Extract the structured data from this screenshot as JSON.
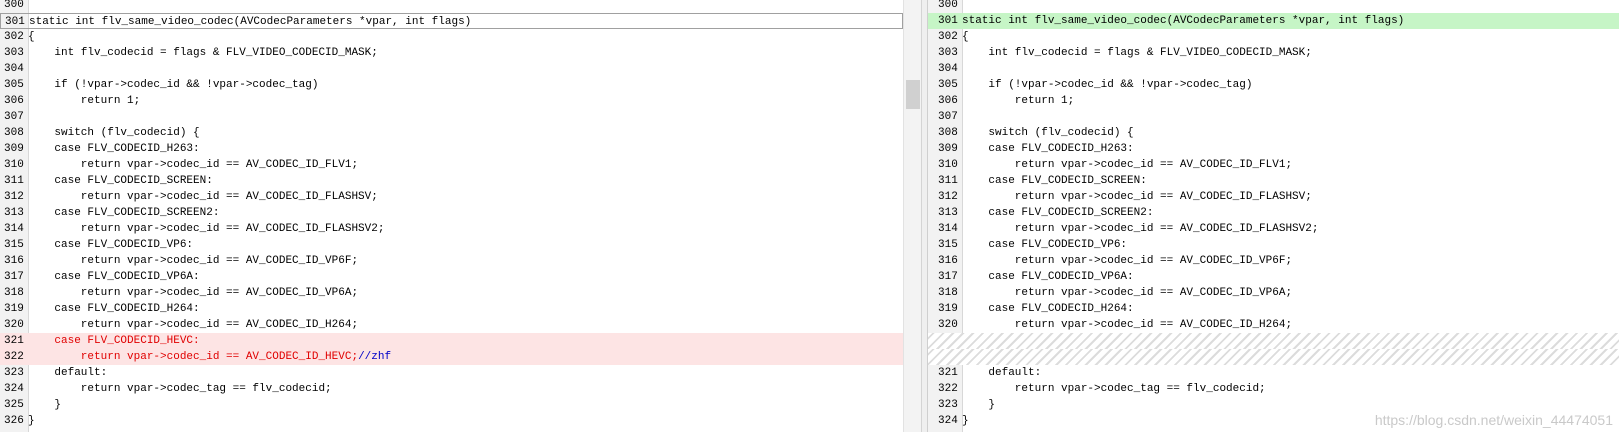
{
  "left_pane": {
    "lines": [
      {
        "num": "300",
        "text": "",
        "style": "normal"
      },
      {
        "num": "301",
        "text": "static int flv_same_video_codec(AVCodecParameters *vpar, int flags)",
        "style": "current"
      },
      {
        "num": "302",
        "text": "{",
        "style": "normal"
      },
      {
        "num": "303",
        "text": "    int flv_codecid = flags & FLV_VIDEO_CODECID_MASK;",
        "style": "normal"
      },
      {
        "num": "304",
        "text": "",
        "style": "normal"
      },
      {
        "num": "305",
        "text": "    if (!vpar->codec_id && !vpar->codec_tag)",
        "style": "normal"
      },
      {
        "num": "306",
        "text": "        return 1;",
        "style": "normal"
      },
      {
        "num": "307",
        "text": "",
        "style": "normal"
      },
      {
        "num": "308",
        "text": "    switch (flv_codecid) {",
        "style": "normal"
      },
      {
        "num": "309",
        "text": "    case FLV_CODECID_H263:",
        "style": "normal"
      },
      {
        "num": "310",
        "text": "        return vpar->codec_id == AV_CODEC_ID_FLV1;",
        "style": "normal"
      },
      {
        "num": "311",
        "text": "    case FLV_CODECID_SCREEN:",
        "style": "normal"
      },
      {
        "num": "312",
        "text": "        return vpar->codec_id == AV_CODEC_ID_FLASHSV;",
        "style": "normal"
      },
      {
        "num": "313",
        "text": "    case FLV_CODECID_SCREEN2:",
        "style": "normal"
      },
      {
        "num": "314",
        "text": "        return vpar->codec_id == AV_CODEC_ID_FLASHSV2;",
        "style": "normal"
      },
      {
        "num": "315",
        "text": "    case FLV_CODECID_VP6:",
        "style": "normal"
      },
      {
        "num": "316",
        "text": "        return vpar->codec_id == AV_CODEC_ID_VP6F;",
        "style": "normal"
      },
      {
        "num": "317",
        "text": "    case FLV_CODECID_VP6A:",
        "style": "normal"
      },
      {
        "num": "318",
        "text": "        return vpar->codec_id == AV_CODEC_ID_VP6A;",
        "style": "normal"
      },
      {
        "num": "319",
        "text": "    case FLV_CODECID_H264:",
        "style": "normal"
      },
      {
        "num": "320",
        "text": "        return vpar->codec_id == AV_CODEC_ID_H264;",
        "style": "normal"
      },
      {
        "num": "321",
        "text": "    case FLV_CODECID_HEVC:",
        "style": "red"
      },
      {
        "num": "322",
        "text": "        return vpar->codec_id == AV_CODEC_ID_HEVC;",
        "comment": "//zhf",
        "style": "red"
      },
      {
        "num": "323",
        "text": "    default:",
        "style": "normal"
      },
      {
        "num": "324",
        "text": "        return vpar->codec_tag == flv_codecid;",
        "style": "normal"
      },
      {
        "num": "325",
        "text": "    }",
        "style": "normal"
      },
      {
        "num": "326",
        "text": "}",
        "style": "normal"
      }
    ]
  },
  "right_pane": {
    "lines": [
      {
        "num": "300",
        "text": "",
        "style": "normal"
      },
      {
        "num": "301",
        "text": "static int flv_same_video_codec(AVCodecParameters *vpar, int flags)",
        "style": "green"
      },
      {
        "num": "302",
        "text": "{",
        "style": "normal"
      },
      {
        "num": "303",
        "text": "    int flv_codecid = flags & FLV_VIDEO_CODECID_MASK;",
        "style": "normal"
      },
      {
        "num": "304",
        "text": "",
        "style": "normal"
      },
      {
        "num": "305",
        "text": "    if (!vpar->codec_id && !vpar->codec_tag)",
        "style": "normal"
      },
      {
        "num": "306",
        "text": "        return 1;",
        "style": "normal"
      },
      {
        "num": "307",
        "text": "",
        "style": "normal"
      },
      {
        "num": "308",
        "text": "    switch (flv_codecid) {",
        "style": "normal"
      },
      {
        "num": "309",
        "text": "    case FLV_CODECID_H263:",
        "style": "normal"
      },
      {
        "num": "310",
        "text": "        return vpar->codec_id == AV_CODEC_ID_FLV1;",
        "style": "normal"
      },
      {
        "num": "311",
        "text": "    case FLV_CODECID_SCREEN:",
        "style": "normal"
      },
      {
        "num": "312",
        "text": "        return vpar->codec_id == AV_CODEC_ID_FLASHSV;",
        "style": "normal"
      },
      {
        "num": "313",
        "text": "    case FLV_CODECID_SCREEN2:",
        "style": "normal"
      },
      {
        "num": "314",
        "text": "        return vpar->codec_id == AV_CODEC_ID_FLASHSV2;",
        "style": "normal"
      },
      {
        "num": "315",
        "text": "    case FLV_CODECID_VP6:",
        "style": "normal"
      },
      {
        "num": "316",
        "text": "        return vpar->codec_id == AV_CODEC_ID_VP6F;",
        "style": "normal"
      },
      {
        "num": "317",
        "text": "    case FLV_CODECID_VP6A:",
        "style": "normal"
      },
      {
        "num": "318",
        "text": "        return vpar->codec_id == AV_CODEC_ID_VP6A;",
        "style": "normal"
      },
      {
        "num": "319",
        "text": "    case FLV_CODECID_H264:",
        "style": "normal"
      },
      {
        "num": "320",
        "text": "        return vpar->codec_id == AV_CODEC_ID_H264;",
        "style": "normal"
      },
      {
        "num": "",
        "text": "",
        "style": "hatch"
      },
      {
        "num": "",
        "text": "",
        "style": "hatch"
      },
      {
        "num": "321",
        "text": "    default:",
        "style": "normal"
      },
      {
        "num": "322",
        "text": "        return vpar->codec_tag == flv_codecid;",
        "style": "normal"
      },
      {
        "num": "323",
        "text": "    }",
        "style": "normal"
      },
      {
        "num": "324",
        "text": "}",
        "style": "normal"
      }
    ]
  },
  "watermark": "https://blog.csdn.net/weixin_44474051",
  "colors": {
    "removed_bg": "#fde4e4",
    "removed_text": "#e00000",
    "changed_bg": "#c6f5c6",
    "comment": "#0000c8"
  }
}
